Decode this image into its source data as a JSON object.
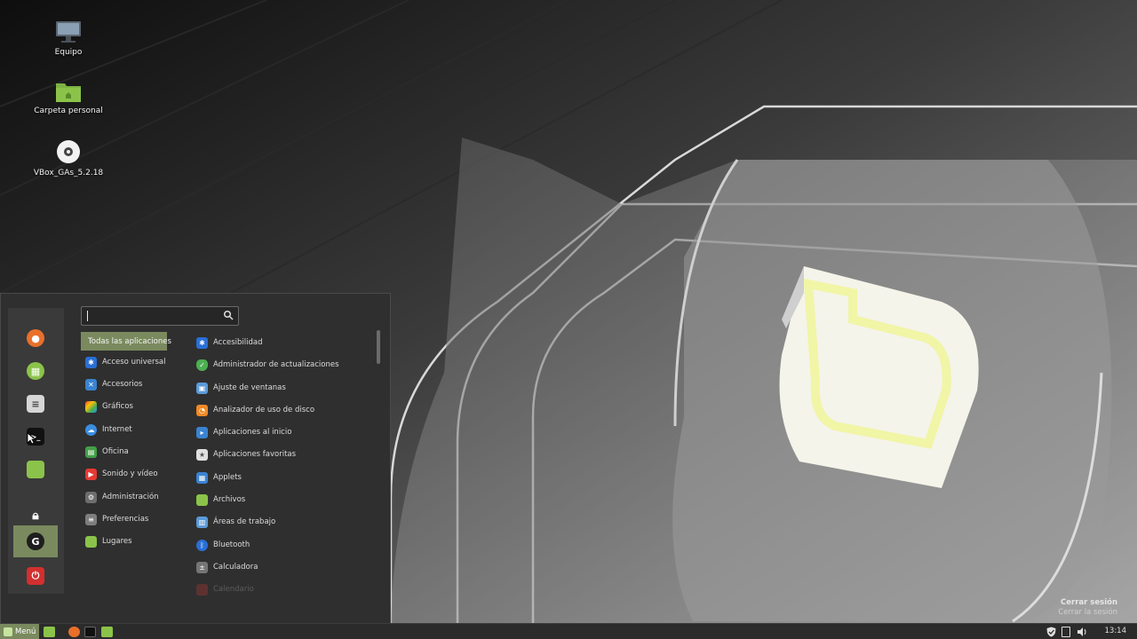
{
  "desktop": {
    "icons": [
      {
        "label": "Equipo",
        "icon": "computer-icon"
      },
      {
        "label": "Carpeta personal",
        "icon": "home-folder-icon"
      },
      {
        "label": "VBox_GAs_5.2.18",
        "icon": "optical-disc-icon"
      }
    ]
  },
  "menu": {
    "search": {
      "value": "",
      "placeholder": ""
    },
    "favorites": [
      {
        "name": "firefox",
        "icon": "firefox-icon",
        "color": "#e8702a"
      },
      {
        "name": "software-manager",
        "icon": "software-manager-icon",
        "color": "#8bc34a"
      },
      {
        "name": "settings",
        "icon": "settings-icon",
        "color": "#9e9e9e"
      },
      {
        "name": "terminal",
        "icon": "terminal-icon",
        "color": "#222222"
      },
      {
        "name": "files",
        "icon": "folder-icon",
        "color": "#8bc34a"
      },
      {
        "name": "lock-screen",
        "icon": "lock-icon",
        "color": "#2b2b2b"
      },
      {
        "name": "logout",
        "icon": "logout-icon",
        "color": "#2b2b2b"
      },
      {
        "name": "shutdown",
        "icon": "power-icon",
        "color": "#d32f2f"
      }
    ],
    "categories": [
      {
        "label": "Todas las aplicaciones",
        "selected": true
      },
      {
        "label": "Acceso universal",
        "icon": "accessibility-icon",
        "color": "#2a6fd6"
      },
      {
        "label": "Accesorios",
        "icon": "accessories-icon",
        "color": "#3a83d1"
      },
      {
        "label": "Gráficos",
        "icon": "graphics-icon",
        "color": "#c2185b"
      },
      {
        "label": "Internet",
        "icon": "internet-icon",
        "color": "#3b8ee0"
      },
      {
        "label": "Oficina",
        "icon": "office-icon",
        "color": "#43a047"
      },
      {
        "label": "Sonido y vídeo",
        "icon": "multimedia-icon",
        "color": "#e53935"
      },
      {
        "label": "Administración",
        "icon": "administration-icon",
        "color": "#6d6d6d"
      },
      {
        "label": "Preferencias",
        "icon": "preferences-icon",
        "color": "#7e7e7e"
      },
      {
        "label": "Lugares",
        "icon": "places-icon",
        "color": "#8bc34a"
      }
    ],
    "apps": [
      {
        "label": "Accesibilidad",
        "icon": "accessibility-icon",
        "color": "#2a6fd6"
      },
      {
        "label": "Administrador de actualizaciones",
        "icon": "update-manager-icon",
        "color": "#4caf50"
      },
      {
        "label": "Ajuste de ventanas",
        "icon": "window-tiling-icon",
        "color": "#5c9ad8"
      },
      {
        "label": "Analizador de uso de disco",
        "icon": "disk-usage-icon",
        "color": "#ef8a26"
      },
      {
        "label": "Aplicaciones al inicio",
        "icon": "startup-apps-icon",
        "color": "#3a83d1"
      },
      {
        "label": "Aplicaciones favoritas",
        "icon": "favorite-apps-icon",
        "color": "#9e9e9e"
      },
      {
        "label": "Applets",
        "icon": "applets-icon",
        "color": "#3a83d1"
      },
      {
        "label": "Archivos",
        "icon": "folder-icon",
        "color": "#8bc34a"
      },
      {
        "label": "Áreas de trabajo",
        "icon": "workspaces-icon",
        "color": "#5c9ad8"
      },
      {
        "label": "Bluetooth",
        "icon": "bluetooth-icon",
        "color": "#2a6fd6"
      },
      {
        "label": "Calculadora",
        "icon": "calculator-icon",
        "color": "#757575"
      },
      {
        "label": "Calendario",
        "icon": "calendar-icon",
        "color": "#e53935"
      }
    ],
    "session": {
      "title": "Cerrar sesión",
      "description": "Cerrar la sesión"
    }
  },
  "panel": {
    "menu_label": "Menú",
    "launchers": [
      "firefox-icon",
      "terminal-icon",
      "folder-icon"
    ],
    "tray": [
      "update-shield-icon",
      "network-icon",
      "volume-icon"
    ],
    "clock": "13:14"
  },
  "colors": {
    "accent": "#7a8a5e",
    "menu_bg": "#2f2f2f",
    "panel_bg": "#2b2b2b"
  }
}
